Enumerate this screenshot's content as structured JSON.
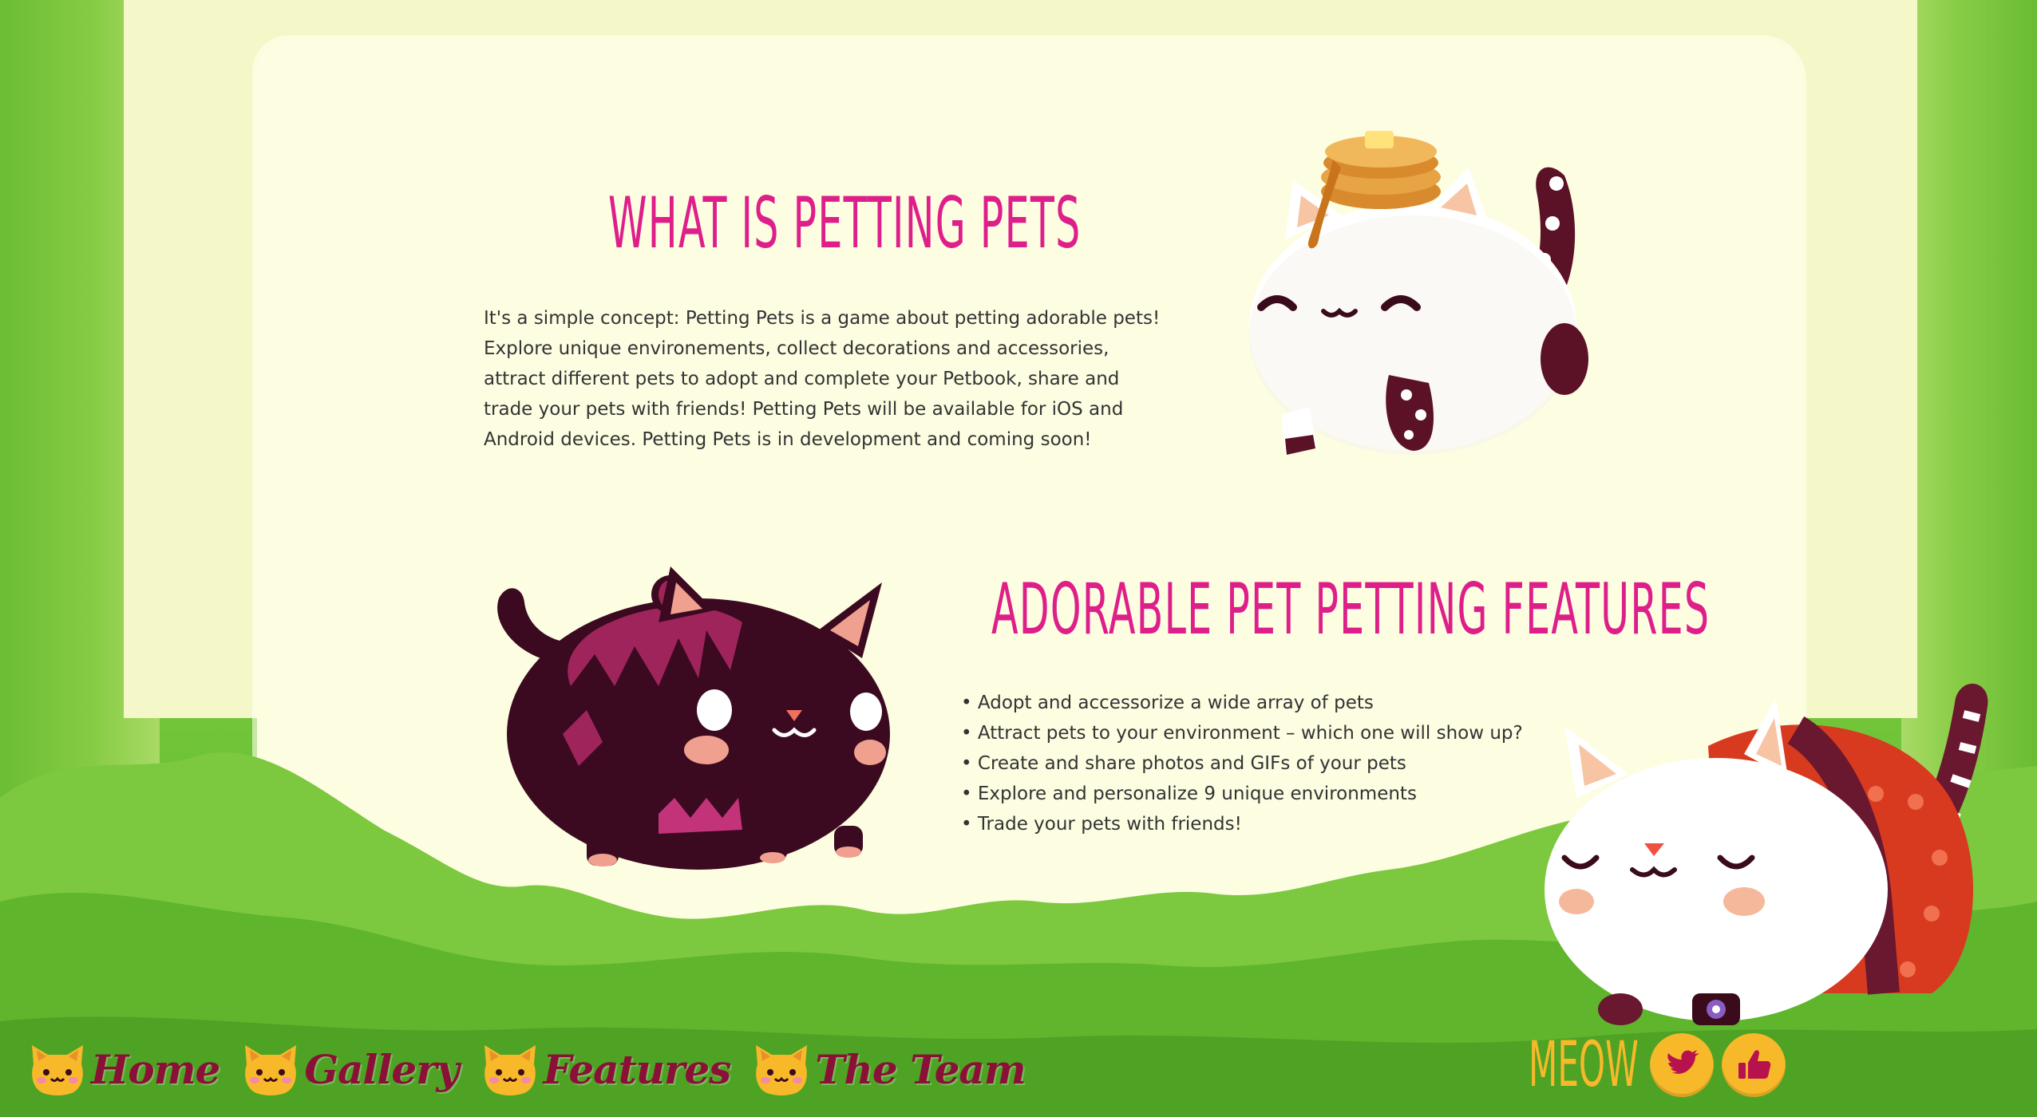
{
  "section_about": {
    "heading": "WHAT IS PETTING PETS",
    "body": "It's a simple concept: Petting Pets is a game about petting adorable pets! Explore unique environements, collect decorations and accessories, attract different pets to adopt and complete your Petbook, share and trade your pets with friends! Petting Pets will be available for iOS and Android devices. Petting Pets is in development and coming soon!"
  },
  "section_features": {
    "heading": "ADORABLE PET PETTING FEATURES",
    "items": [
      "Adopt and accessorize a wide array of pets",
      "Attract pets to your environment – which one will show up?",
      "Create and share photos and GIFs of your pets",
      "Explore and personalize 9 unique environments",
      "Trade your pets with friends!"
    ]
  },
  "nav": {
    "items": [
      {
        "label": "Home",
        "icon": "cat-face-icon"
      },
      {
        "label": "Gallery",
        "icon": "cat-face-icon"
      },
      {
        "label": "Features",
        "icon": "cat-face-icon"
      },
      {
        "label": "The Team",
        "icon": "cat-face-icon"
      }
    ]
  },
  "social": {
    "label": "MEOW",
    "buttons": [
      {
        "icon": "twitter-bird-icon"
      },
      {
        "icon": "thumbs-up-icon"
      }
    ]
  },
  "colors": {
    "heading": "#de1f8a",
    "nav_text": "#8a1038",
    "accent": "#f7b92a",
    "paper": "#fdfde2",
    "grass": "#6cc235"
  }
}
